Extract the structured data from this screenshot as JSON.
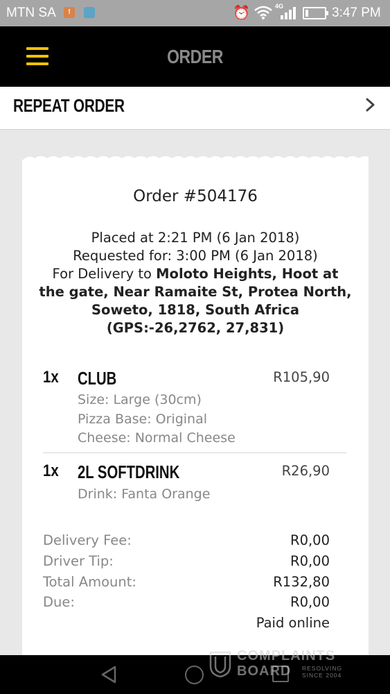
{
  "status_bar": {
    "carrier": "MTN SA",
    "time": "3:47 PM",
    "network": "4G"
  },
  "header": {
    "title": "ORDER"
  },
  "repeat_order": {
    "label": "REPEAT ORDER"
  },
  "order": {
    "title": "Order #504176",
    "placed_at": "Placed at 2:21 PM (6 Jan 2018)",
    "requested_for": "Requested for: 3:00 PM (6 Jan 2018)",
    "delivery_prefix": "For Delivery to ",
    "delivery_address": "Moloto Heights, Hoot at the gate, Near Ramaite St, Protea North, Soweto, 1818, South Africa (GPS:-26,2762, 27,831)",
    "items": [
      {
        "qty": "1x",
        "name": "CLUB",
        "price": "R105,90",
        "options": [
          "Size: Large (30cm)",
          "Pizza Base: Original",
          "Cheese: Normal Cheese"
        ]
      },
      {
        "qty": "1x",
        "name": "2L SOFTDRINK",
        "price": "R26,90",
        "options": [
          "Drink: Fanta Orange"
        ]
      }
    ],
    "summary": {
      "delivery_fee_label": "Delivery Fee:",
      "delivery_fee": "R0,00",
      "driver_tip_label": "Driver Tip:",
      "driver_tip": "R0,00",
      "total_label": "Total Amount:",
      "total": "R132,80",
      "due_label": "Due:",
      "due": "R0,00",
      "payment_status": "Paid online"
    }
  },
  "watermark": {
    "line1": "COMPLAINTS",
    "line2": "BOARD",
    "tag1": "RESOLVING",
    "tag2": "SINCE 2004"
  },
  "colors": {
    "accent": "#f2c300",
    "header_bg": "#000000",
    "status_bar_bg": "#a6a6a6",
    "page_bg": "#e8e8e8"
  }
}
